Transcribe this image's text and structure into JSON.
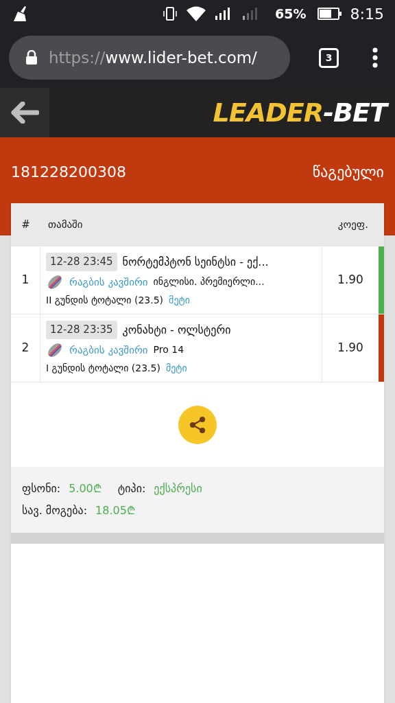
{
  "status_bar": {
    "battery_percent": "65%",
    "time": "8:15"
  },
  "browser": {
    "url_scheme": "https://",
    "url_rest": "www.lider-bet.com/",
    "tab_count": "3"
  },
  "header": {
    "logo_left": "LEADER",
    "logo_dash": "-",
    "logo_right": "BET"
  },
  "ticket": {
    "number": "181228200308",
    "status": "წაგებული"
  },
  "table": {
    "columns": [
      "#",
      "თამაში",
      "კოეფ."
    ],
    "rows": [
      {
        "index": "1",
        "time": "12-28 23:45",
        "match": "ნორტემპტონ სეინტსი - ექ...",
        "sport": "რაგბის კავშირი",
        "league": "ინგლისი. პრემიერლი...",
        "market": "II გუნდის ტოტალი (23.5)",
        "pick": "მეტი",
        "odds": "1.90",
        "color": "#4caf50"
      },
      {
        "index": "2",
        "time": "12-28 23:35",
        "match": "კონახტი - ოლსტერი",
        "sport": "რაგბის კავშირი",
        "league": "Pro 14",
        "market": "I გუნდის ტოტალი (23.5)",
        "pick": "მეტი",
        "odds": "1.90",
        "color": "#c0390f"
      }
    ]
  },
  "summary": {
    "stake_label": "ფსონი:",
    "stake": "5.00₾",
    "type_label": "ტიპი:",
    "type": "ექსპრესი",
    "win_label": "სავ. მოგება:",
    "win": "18.05₾"
  }
}
